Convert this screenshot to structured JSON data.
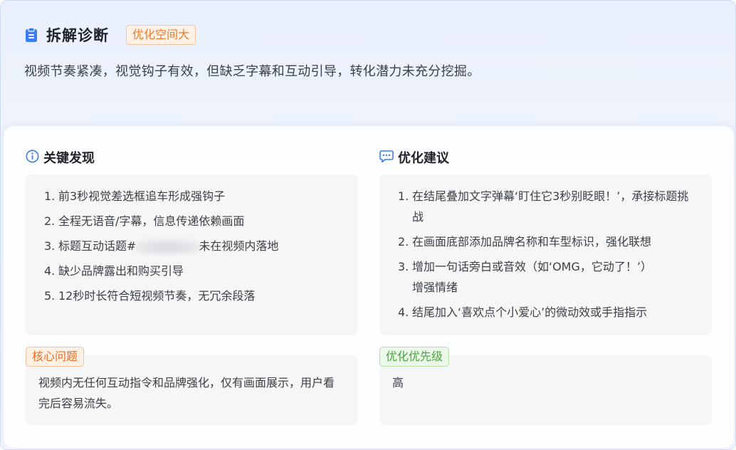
{
  "header": {
    "title": "拆解诊断",
    "badge": "优化空间大",
    "summary": "视频节奏紧凑，视觉钩子有效，但缺乏字幕和互动引导，转化潜力未充分挖掘。"
  },
  "findings": {
    "title": "关键发现",
    "items": [
      {
        "num": "1.",
        "text": "前3秒视觉差选框追车形成强钩子"
      },
      {
        "num": "2.",
        "text": "全程无语音/字幕，信息传递依赖画面"
      },
      {
        "num": "3.",
        "text_before": "标题互动话题#",
        "text_after": "未在视频内落地"
      },
      {
        "num": "4.",
        "text": "缺少品牌露出和购买引导"
      },
      {
        "num": "5.",
        "text": "12秒时长符合短视频节奏，无冗余段落"
      }
    ]
  },
  "suggestions": {
    "title": "优化建议",
    "items": [
      {
        "num": "1.",
        "text": "在结尾叠加文字弹幕‘盯住它3秒别眨眼！’，承接标题挑战"
      },
      {
        "num": "2.",
        "text": "在画面底部添加品牌名称和车型标识，强化联想"
      },
      {
        "num": "3.",
        "text": "增加一句话旁白或音效（如‘OMG，它动了！’）增强情绪"
      },
      {
        "num": "4.",
        "text": "结尾加入‘喜欢点个小爱心’的微动效或手指指示"
      }
    ]
  },
  "core_issue": {
    "label": "核心问题",
    "text": "视频内无任何互动指令和品牌强化，仅有画面展示，用户看完后容易流失。"
  },
  "priority": {
    "label": "优化优先级",
    "value": "高"
  },
  "colors": {
    "accent_blue": "#3b7cf5",
    "badge_orange": "#f07a2c",
    "tag_green": "#4aa344"
  }
}
